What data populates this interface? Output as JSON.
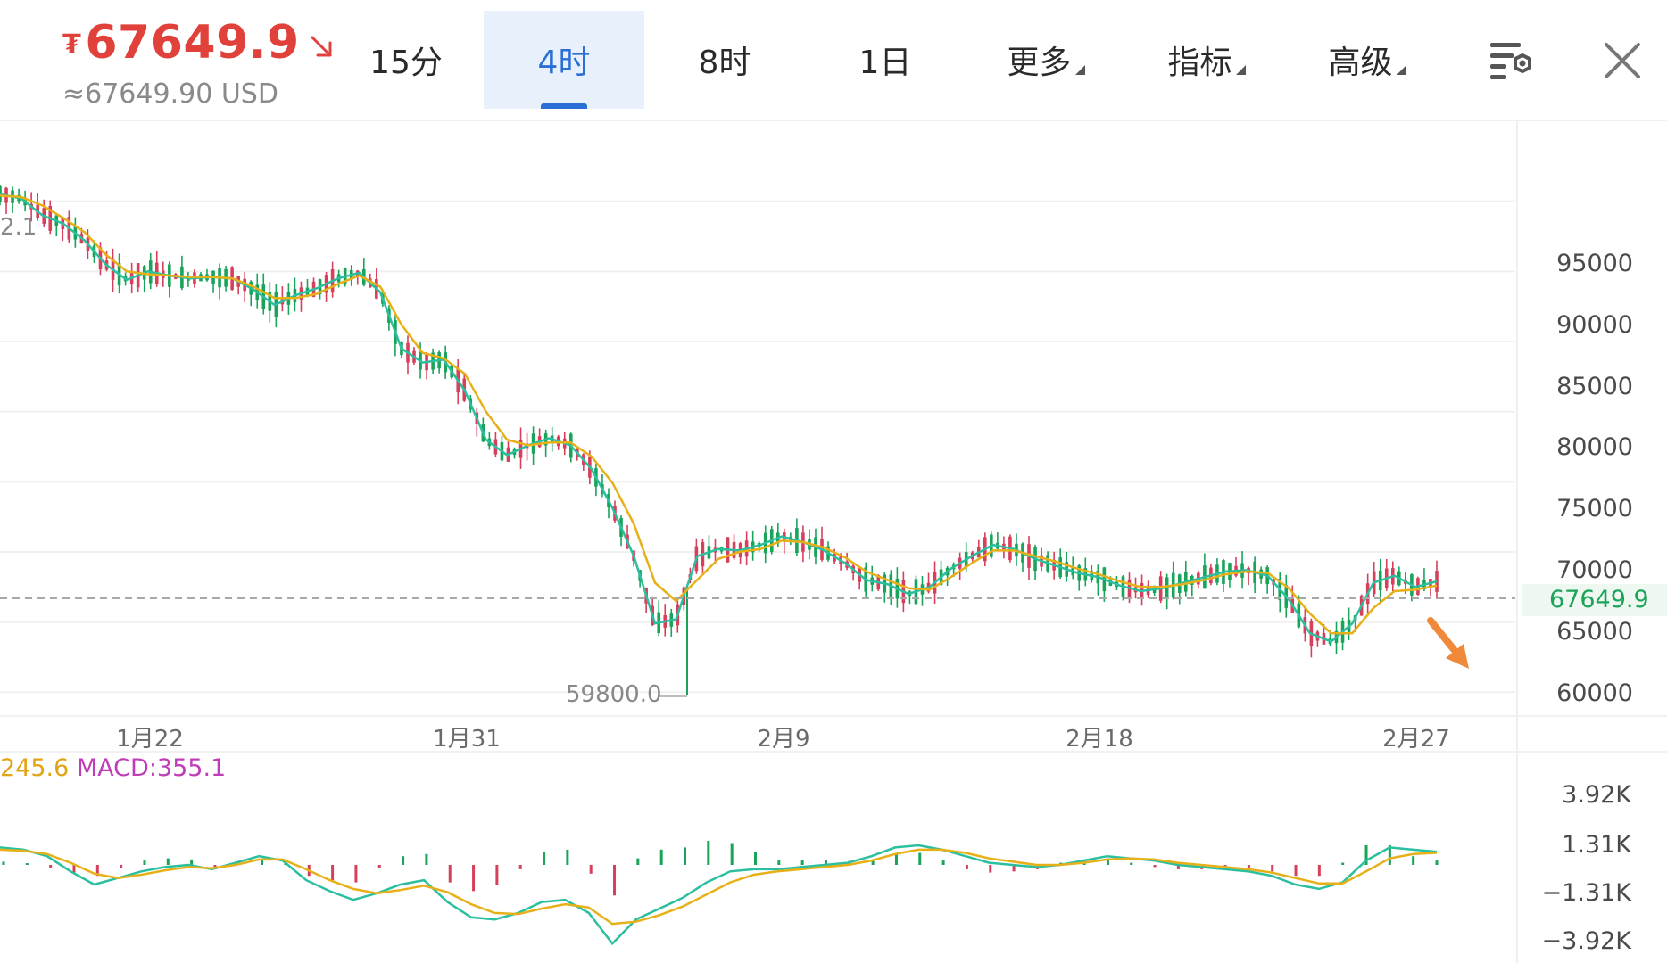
{
  "header": {
    "currency_symbol": "₮",
    "price": "67649.9",
    "price_usd": "≈67649.90 USD",
    "price_color": "#e0423b",
    "trend_icon": "down-arrow-icon"
  },
  "tabs": [
    {
      "label": "15分",
      "active": false,
      "dropdown": false
    },
    {
      "label": "4时",
      "active": true,
      "dropdown": false
    },
    {
      "label": "8时",
      "active": false,
      "dropdown": false
    },
    {
      "label": "1日",
      "active": false,
      "dropdown": false
    },
    {
      "label": "更多",
      "active": false,
      "dropdown": true
    },
    {
      "label": "指标",
      "active": false,
      "dropdown": true
    },
    {
      "label": "高级",
      "active": false,
      "dropdown": true
    }
  ],
  "toolbar_icons": [
    "chart-settings-icon",
    "close-icon"
  ],
  "accent_color": "#2b6fd6",
  "up_color": "#1aa45a",
  "down_color": "#d6405a",
  "chart_data": {
    "type": "line",
    "y_ticks": [
      "95000",
      "90000",
      "85000",
      "80000",
      "75000",
      "70000",
      "65000",
      "60000"
    ],
    "ylim": [
      58300,
      100700
    ],
    "x_ticks": [
      "1月22",
      "1月31",
      "2月9",
      "2月18",
      "2月27"
    ],
    "current_price_label": "67649.9",
    "current_price": 67649.9,
    "low_label": "59800.0",
    "top_partial_label": "2.1",
    "grid": true,
    "series": [
      {
        "name": "MA-fast",
        "color": "#2bbfa0",
        "values": [
          95500,
          95200,
          94000,
          93400,
          92200,
          90500,
          89400,
          90000,
          89700,
          89500,
          89600,
          89500,
          88700,
          87600,
          88300,
          88800,
          89500,
          89900,
          88500,
          84500,
          83500,
          83700,
          81500,
          78000,
          76900,
          77600,
          78100,
          77600,
          75900,
          73100,
          69700,
          64900,
          65200,
          69700,
          70200,
          70100,
          70500,
          71100,
          70700,
          70100,
          69200,
          68000,
          67700,
          67000,
          67500,
          68800,
          69700,
          70500,
          70200,
          69500,
          69000,
          68500,
          68200,
          67600,
          67200,
          67400,
          67800,
          68200,
          68600,
          68700,
          68300,
          66600,
          64200,
          63600,
          64900,
          67800,
          68300,
          67500,
          67900
        ]
      },
      {
        "name": "MA-slow",
        "color": "#e7b018",
        "values": [
          95400,
          95300,
          94700,
          93800,
          92800,
          91200,
          90000,
          89800,
          89700,
          89600,
          89600,
          89500,
          88900,
          88100,
          88100,
          88400,
          89100,
          89700,
          88900,
          86200,
          84200,
          83800,
          82700,
          80000,
          78000,
          77600,
          77800,
          77800,
          76800,
          74900,
          72000,
          67800,
          66500,
          68000,
          69500,
          70000,
          70200,
          70800,
          70700,
          70300,
          69600,
          68600,
          68000,
          67400,
          67300,
          68200,
          69200,
          70100,
          70100,
          69700,
          69300,
          68800,
          68400,
          67900,
          67500,
          67500,
          67700,
          68000,
          68400,
          68600,
          68500,
          67400,
          65600,
          64200,
          64200,
          66000,
          67200,
          67300,
          67600
        ]
      }
    ]
  },
  "macd": {
    "legend_a": "245.6",
    "legend_b": "MACD:355.1",
    "y_ticks": [
      "3.92K",
      "1.31K",
      "−1.31K",
      "−3.92K"
    ],
    "ylim": [
      -3920,
      3920
    ],
    "dif_color": "#2bbfa0",
    "dea_color": "#e7b018",
    "dif": [
      800,
      700,
      400,
      -300,
      -900,
      -600,
      -300,
      -100,
      0,
      -200,
      100,
      400,
      200,
      -700,
      -1200,
      -1600,
      -1300,
      -900,
      -700,
      -1700,
      -2400,
      -2500,
      -2200,
      -1700,
      -1600,
      -2200,
      -3600,
      -2500,
      -2000,
      -1500,
      -800,
      -300,
      -200,
      -200,
      -100,
      0,
      100,
      400,
      800,
      900,
      700,
      400,
      100,
      0,
      -100,
      0,
      200,
      400,
      300,
      200,
      0,
      -100,
      -200,
      -300,
      -500,
      -900,
      -1100,
      -800,
      200,
      800,
      700,
      600
    ],
    "dea": [
      700,
      650,
      500,
      100,
      -400,
      -600,
      -450,
      -250,
      -100,
      -150,
      0,
      250,
      250,
      -200,
      -700,
      -1100,
      -1300,
      -1150,
      -950,
      -1250,
      -1800,
      -2200,
      -2250,
      -2000,
      -1800,
      -1950,
      -2700,
      -2600,
      -2300,
      -1900,
      -1350,
      -800,
      -450,
      -300,
      -200,
      -100,
      0,
      200,
      500,
      700,
      700,
      550,
      300,
      150,
      0,
      0,
      100,
      250,
      300,
      250,
      100,
      0,
      -100,
      -200,
      -350,
      -600,
      -850,
      -850,
      -300,
      300,
      500,
      550
    ],
    "hist": [
      150,
      80,
      -120,
      -400,
      -500,
      -150,
      200,
      300,
      250,
      -120,
      180,
      300,
      100,
      -500,
      -700,
      -800,
      -150,
      400,
      500,
      -800,
      -1200,
      -900,
      -200,
      600,
      700,
      -400,
      -1400,
      300,
      700,
      800,
      1100,
      1000,
      600,
      200,
      200,
      200,
      180,
      250,
      500,
      550,
      200,
      -200,
      -350,
      -300,
      -200,
      100,
      250,
      300,
      100,
      -100,
      -200,
      -200,
      -200,
      -200,
      -300,
      -500,
      -500,
      100,
      900,
      900,
      400,
      200
    ]
  }
}
